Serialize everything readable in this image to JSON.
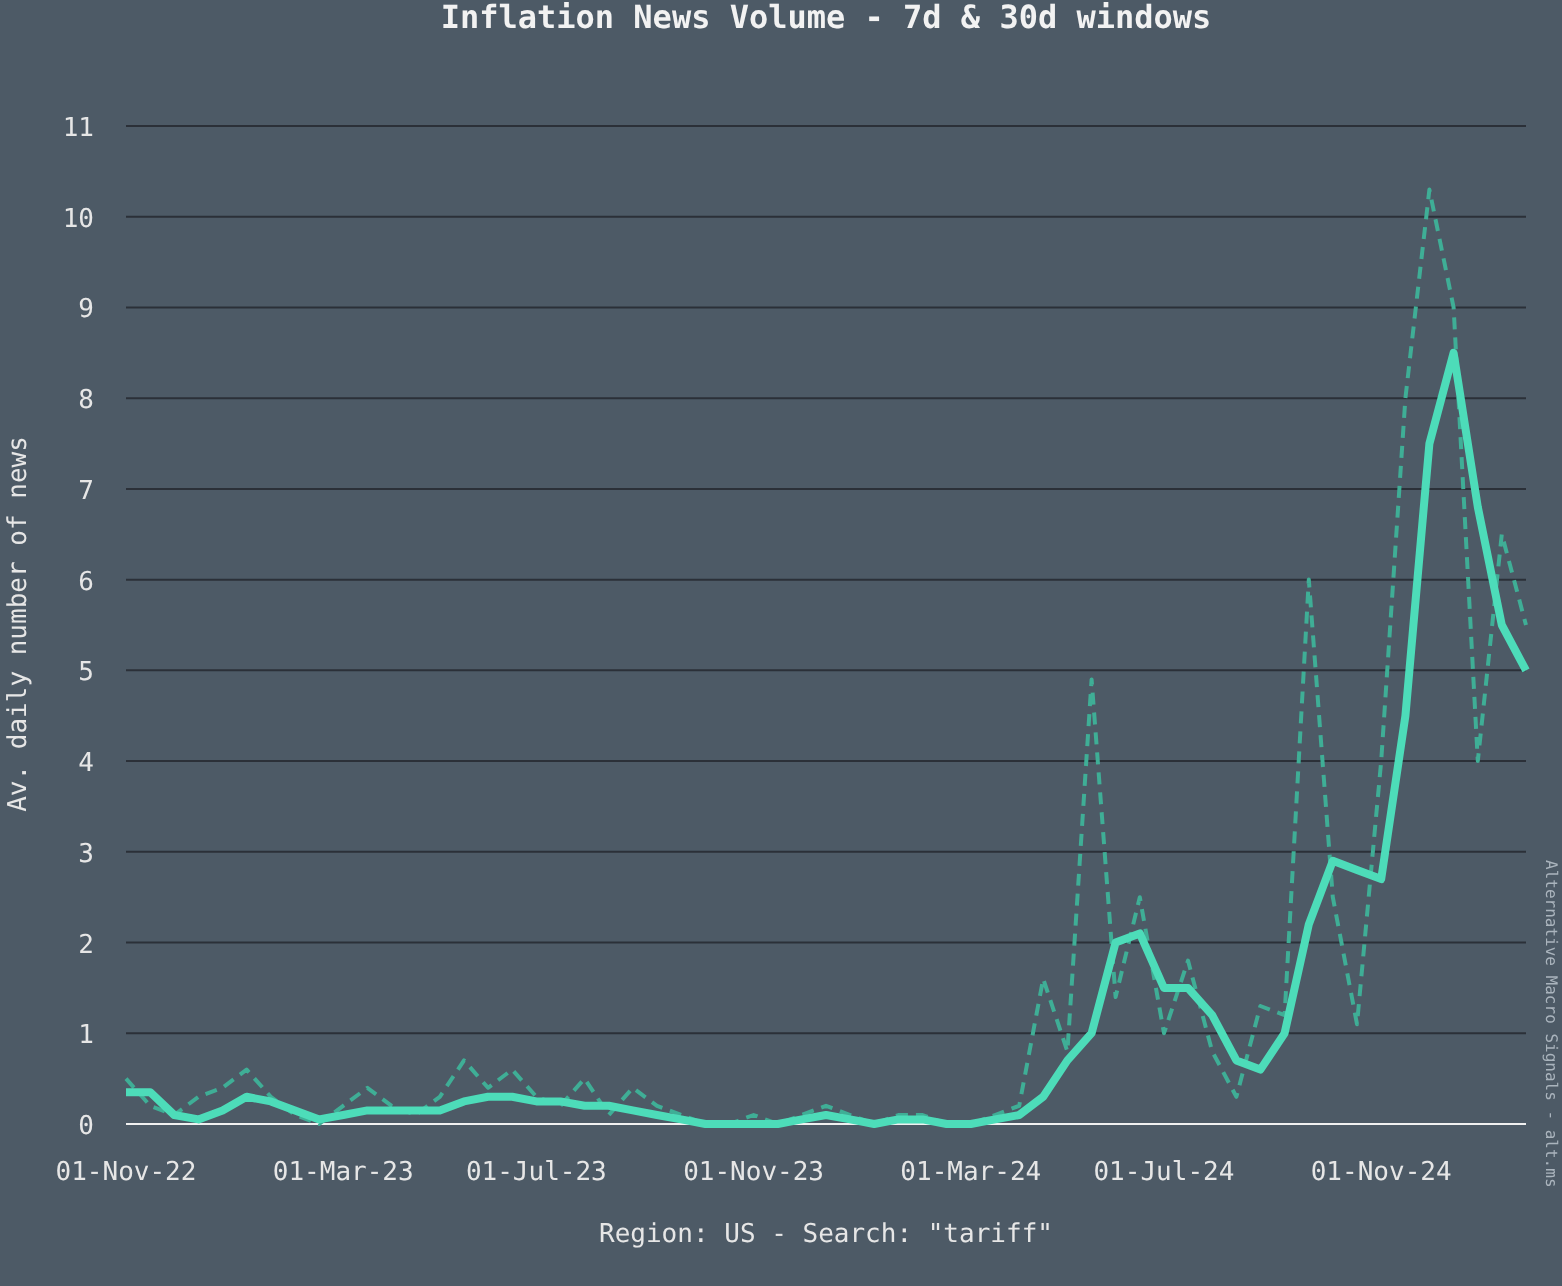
{
  "chart": {
    "chart_data": {
      "type": "line",
      "title": "Inflation News Volume - 7d & 30d windows",
      "xlabel": "Region: US - Search: \"tariff\"",
      "ylabel": "Av. daily number of news",
      "categories": [
        "01-Nov-22",
        null,
        null,
        null,
        null,
        null,
        null,
        null,
        null,
        "01-Mar-23",
        null,
        null,
        null,
        null,
        null,
        null,
        null,
        "01-Jul-23",
        null,
        null,
        null,
        null,
        null,
        null,
        null,
        null,
        "01-Nov-23",
        null,
        null,
        null,
        null,
        null,
        null,
        null,
        null,
        "01-Mar-24",
        null,
        null,
        null,
        null,
        null,
        null,
        null,
        "01-Jul-24",
        null,
        null,
        null,
        null,
        null,
        null,
        null,
        null,
        "01-Nov-24",
        null,
        null,
        null,
        null,
        null,
        null
      ],
      "series": [
        {
          "color": "#3fae96",
          "line_style": "dashed",
          "values": [
            0.5,
            0.2,
            0.1,
            0.3,
            0.4,
            0.6,
            0.3,
            0.1,
            0.0,
            0.2,
            0.4,
            0.2,
            0.1,
            0.3,
            0.7,
            0.4,
            0.6,
            0.3,
            0.2,
            0.5,
            0.1,
            0.4,
            0.2,
            0.1,
            0.0,
            0.0,
            0.1,
            0.0,
            0.1,
            0.2,
            0.1,
            0.0,
            0.1,
            0.1,
            0.0,
            0.0,
            0.1,
            0.2,
            1.6,
            0.8,
            4.9,
            1.4,
            2.5,
            1.0,
            1.8,
            0.8,
            0.3,
            1.3,
            1.2,
            6.0,
            2.5,
            1.1,
            4.0,
            8.0,
            10.3,
            9.0,
            4.0,
            6.5,
            5.5
          ]
        },
        {
          "color": "#4ddcb9",
          "line_style": "solid",
          "values": [
            0.35,
            0.35,
            0.1,
            0.05,
            0.15,
            0.3,
            0.25,
            0.15,
            0.05,
            0.1,
            0.15,
            0.15,
            0.15,
            0.15,
            0.25,
            0.3,
            0.3,
            0.25,
            0.25,
            0.2,
            0.2,
            0.15,
            0.1,
            0.05,
            0.0,
            0.0,
            0.0,
            0.0,
            0.05,
            0.1,
            0.05,
            0.0,
            0.05,
            0.05,
            0.0,
            0.0,
            0.05,
            0.1,
            0.3,
            0.7,
            1.0,
            2.0,
            2.1,
            1.5,
            1.5,
            1.2,
            0.7,
            0.6,
            1.0,
            2.2,
            2.9,
            2.8,
            2.7,
            4.5,
            7.5,
            8.5,
            6.8,
            5.5,
            5.0
          ]
        }
      ],
      "ylim": [
        0,
        11
      ],
      "grid": true,
      "yticks": [
        0,
        1,
        2,
        3,
        4,
        5,
        6,
        7,
        8,
        9,
        10,
        11
      ]
    },
    "credit": "Alternative Macro Signals - alt.ms"
  }
}
